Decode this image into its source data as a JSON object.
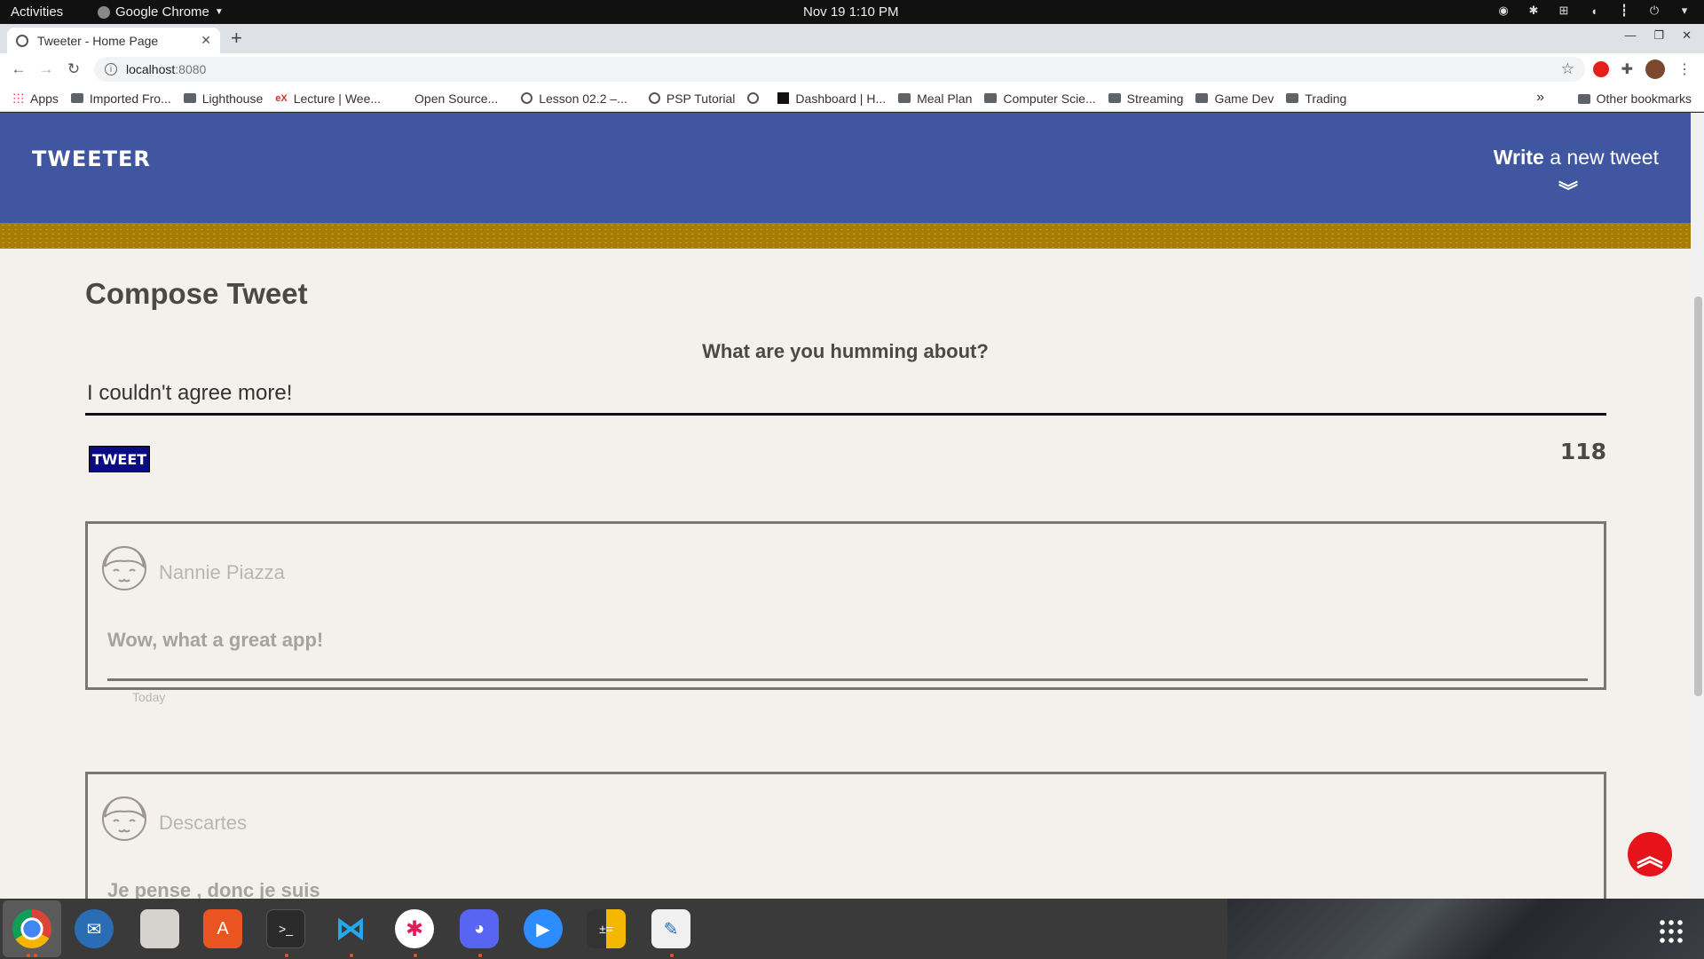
{
  "system": {
    "activities": "Activities",
    "app_name": "Google Chrome",
    "clock": "Nov 19  1:10 PM"
  },
  "browser": {
    "tab_title": "Tweeter - Home Page",
    "url_host": "localhost",
    "url_port": ":8080",
    "bookmarks": [
      "Apps",
      "Imported Fro...",
      "Lighthouse",
      "Lecture | Wee...",
      "Open Source...",
      "Lesson 02.2 –...",
      "PSP Tutorial",
      "",
      "Dashboard | H...",
      "Meal Plan",
      "Computer Scie...",
      "Streaming",
      "Game Dev",
      "Trading"
    ],
    "overflow": "»",
    "other_bookmarks": "Other bookmarks"
  },
  "nav": {
    "brand": "TWEETER",
    "write_bold": "Write",
    "write_rest": " a new tweet"
  },
  "compose": {
    "title": "Compose Tweet",
    "label": "What are you humming about?",
    "text": "I couldn't agree more!",
    "button": "TWEET",
    "counter": "118"
  },
  "tweets": [
    {
      "author": "Nannie Piazza",
      "content": "Wow, what a great app!",
      "date": "Today"
    },
    {
      "author": "Descartes",
      "content": "Je pense , donc je suis",
      "date": ""
    }
  ]
}
